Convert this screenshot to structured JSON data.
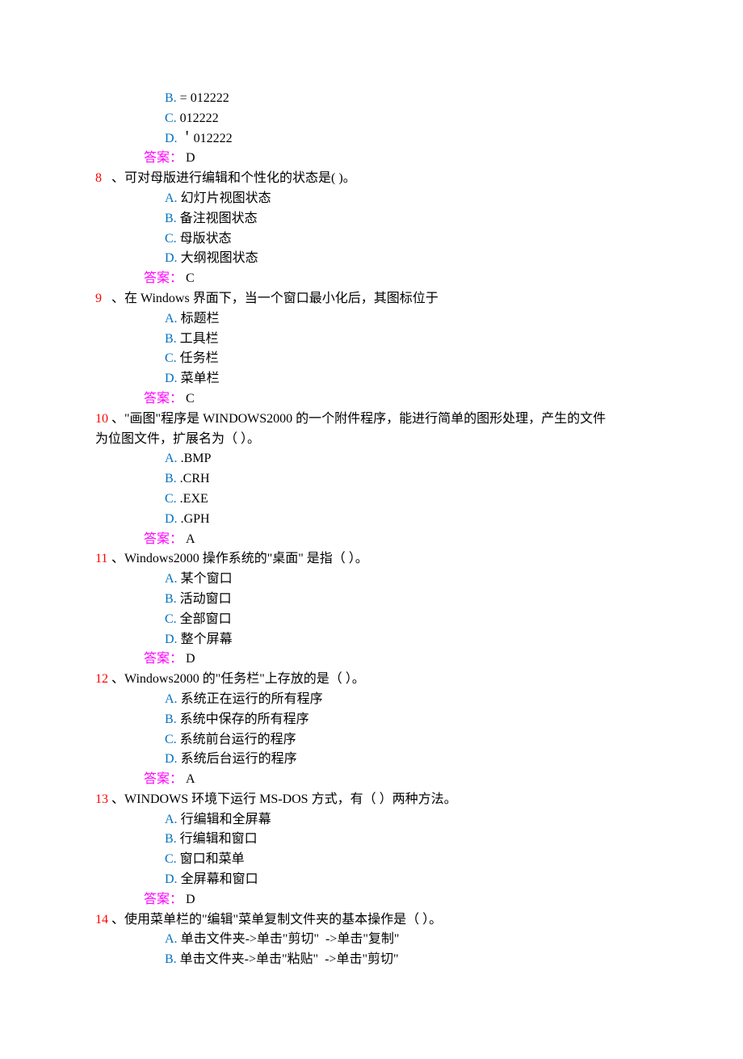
{
  "frag7": {
    "optB": "= 012222",
    "optC": "012222",
    "optD": "＇012222",
    "answer": "D"
  },
  "q8": {
    "num": "8",
    "text": "可对母版进行编辑和个性化的状态是(        )。",
    "optA": "幻灯片视图状态",
    "optB": "备注视图状态",
    "optC": "母版状态",
    "optD": "大纲视图状态",
    "answer": "C"
  },
  "q9": {
    "num": "9",
    "text": "在 Windows 界面下，当一个窗口最小化后，其图标位于",
    "optA": "标题栏",
    "optB": "工具栏",
    "optC": "任务栏",
    "optD": "菜单栏",
    "answer": "C"
  },
  "q10": {
    "num": "10",
    "text1": "\"画图\"程序是 WINDOWS2000 的一个附件程序，能进行简单的图形处理，产生的文件",
    "text2": "为位图文件，扩展名为（        ）。",
    "optA": ".BMP",
    "optB": ".CRH",
    "optC": ".EXE",
    "optD": ".GPH",
    "answer": "A"
  },
  "q11": {
    "num": "11",
    "text": "Windows2000 操作系统的\"桌面\"   是指（      ）。",
    "optA": "某个窗口",
    "optB": "活动窗口",
    "optC": "全部窗口",
    "optD": "整个屏幕",
    "answer": "D"
  },
  "q12": {
    "num": "12",
    "text": "Windows2000 的\"任务栏\"上存放的是（        ）。",
    "optA": "系统正在运行的所有程序",
    "optB": "系统中保存的所有程序",
    "optC": "系统前台运行的程序",
    "optD": "系统后台运行的程序",
    "answer": "A"
  },
  "q13": {
    "num": "13",
    "text": "WINDOWS   环境下运行 MS-DOS 方式，有（      ）两种方法。",
    "optA": "行编辑和全屏幕",
    "optB": "行编辑和窗口",
    "optC": "窗口和菜单",
    "optD": "全屏幕和窗口",
    "answer": "D"
  },
  "q14": {
    "num": "14",
    "text": "使用菜单栏的\"编辑\"菜单复制文件夹的基本操作是（        ）。",
    "optA": "单击文件夹->单击\"剪切\"  ->单击\"复制\"",
    "optB": "单击文件夹->单击\"粘贴\"  ->单击\"剪切\""
  },
  "labels": {
    "answer": "答案：",
    "sep": "、 ",
    "sep_wide": "、  "
  }
}
